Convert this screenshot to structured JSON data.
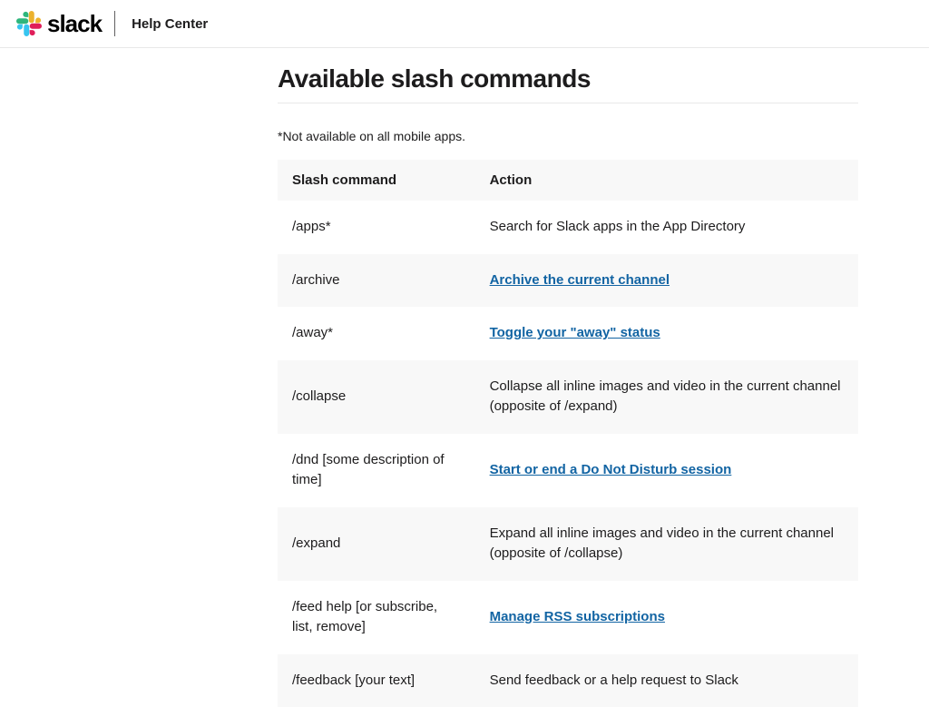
{
  "header": {
    "brand": "slack",
    "help_center": "Help Center"
  },
  "main": {
    "title": "Available slash commands",
    "note": "*Not available on all mobile apps.",
    "table": {
      "col_command": "Slash command",
      "col_action": "Action",
      "rows": [
        {
          "command": "/apps*",
          "action": "Search for Slack apps in the App Directory",
          "link": false
        },
        {
          "command": "/archive",
          "action": "Archive the current channel",
          "link": true
        },
        {
          "command": "/away*",
          "action": "Toggle your \"away\" status",
          "link": true
        },
        {
          "command": "/collapse",
          "action": "Collapse all inline images and video in the current channel (opposite of /expand)",
          "link": false
        },
        {
          "command": "/dnd [some description of time]",
          "action": "Start or end a Do Not Disturb session",
          "link": true
        },
        {
          "command": "/expand",
          "action": "Expand all inline images and video in the current channel (opposite of /collapse)",
          "link": false
        },
        {
          "command": "/feed help [or subscribe, list, remove]",
          "action": "Manage RSS subscriptions",
          "link": true
        },
        {
          "command": "/feedback [your text]",
          "action": "Send feedback or a help request to Slack",
          "link": false
        }
      ]
    }
  }
}
